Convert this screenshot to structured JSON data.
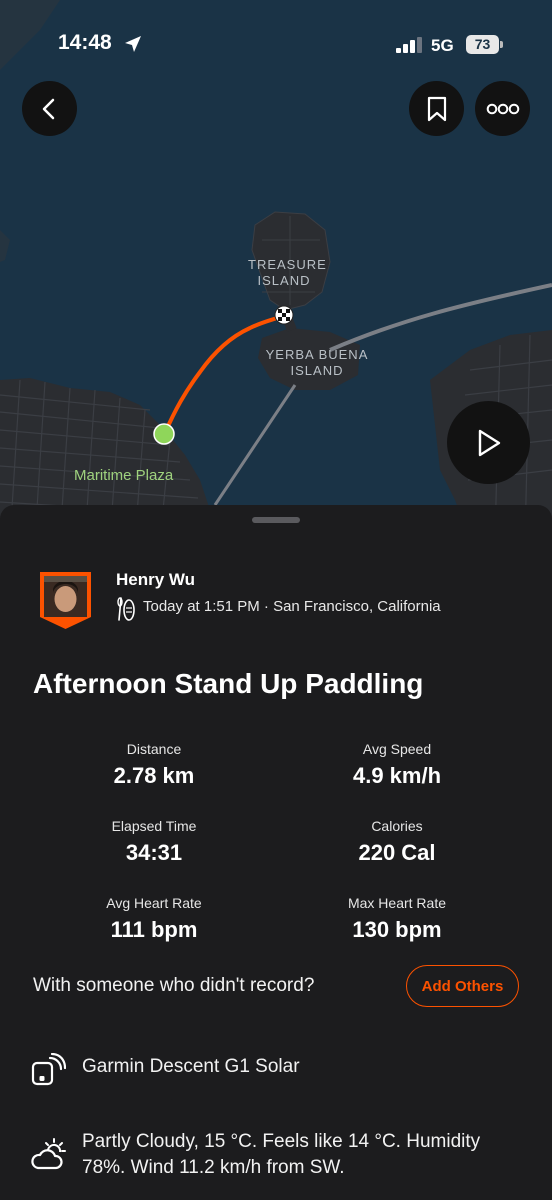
{
  "status_bar": {
    "time": "14:48",
    "network": "5G",
    "battery": "73"
  },
  "map": {
    "labels": {
      "treasure_island": "TREASURE\nISLAND",
      "yerba_buena_island": "YERBA BUENA\nISLAND",
      "maritime_plaza": "Maritime Plaza"
    },
    "route_color": "#fc5200",
    "start_marker_color": "#8fd65a"
  },
  "activity": {
    "athlete_name": "Henry Wu",
    "meta": "Today at 1:51 PM · San Francisco, California",
    "title": "Afternoon Stand Up Paddling",
    "stats": [
      {
        "label": "Distance",
        "value": "2.78 km"
      },
      {
        "label": "Avg Speed",
        "value": "4.9 km/h"
      },
      {
        "label": "Elapsed Time",
        "value": "34:31"
      },
      {
        "label": "Calories",
        "value": "220 Cal"
      },
      {
        "label": "Avg Heart Rate",
        "value": "111 bpm"
      },
      {
        "label": "Max Heart Rate",
        "value": "130 bpm"
      }
    ],
    "with_someone": "With someone who didn't record?",
    "add_others_label": "Add Others",
    "device": "Garmin Descent G1 Solar",
    "weather": "Partly Cloudy, 15 °C. Feels like 14 °C. Humidity 78%. Wind 11.2 km/h from SW."
  },
  "colors": {
    "accent": "#fc5200",
    "sheet_bg": "#1c1c1e",
    "water": "#1a3346"
  }
}
